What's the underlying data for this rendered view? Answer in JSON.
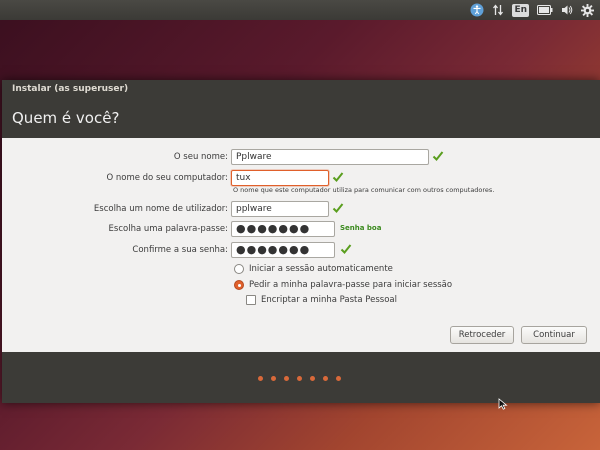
{
  "tray": {
    "language": "En",
    "icons": [
      "accessibility-icon",
      "network-icon",
      "keyboard-language-icon",
      "battery-icon",
      "volume-icon",
      "gear-icon"
    ]
  },
  "window": {
    "title": "Instalar (as superuser)",
    "heading": "Quem é você?"
  },
  "form": {
    "name_label": "O seu nome:",
    "name_value": "Pplware",
    "computer_label": "O nome do seu computador:",
    "computer_value": "tux",
    "computer_hint": "O nome que este computador utiliza para comunicar com outros computadores.",
    "username_label": "Escolha um nome de utilizador:",
    "username_value": "pplware",
    "password_label": "Escolha uma palavra-passe:",
    "password_mask": "●●●●●●●",
    "password_strength": "Senha boa",
    "confirm_label": "Confirme a sua senha:",
    "confirm_mask": "●●●●●●●"
  },
  "options": {
    "auto_login": "Iniciar a sessão automaticamente",
    "require_password": "Pedir a minha palavra-passe para iniciar sessão",
    "encrypt_home": "Encriptar a minha Pasta Pessoal",
    "selected": "require_password"
  },
  "buttons": {
    "back": "Retroceder",
    "continue": "Continuar"
  },
  "progress": {
    "total_steps": 7
  },
  "colors": {
    "accent": "#e0602b",
    "check_green": "#5a9e1e",
    "panel_dark": "#3c3b37"
  }
}
